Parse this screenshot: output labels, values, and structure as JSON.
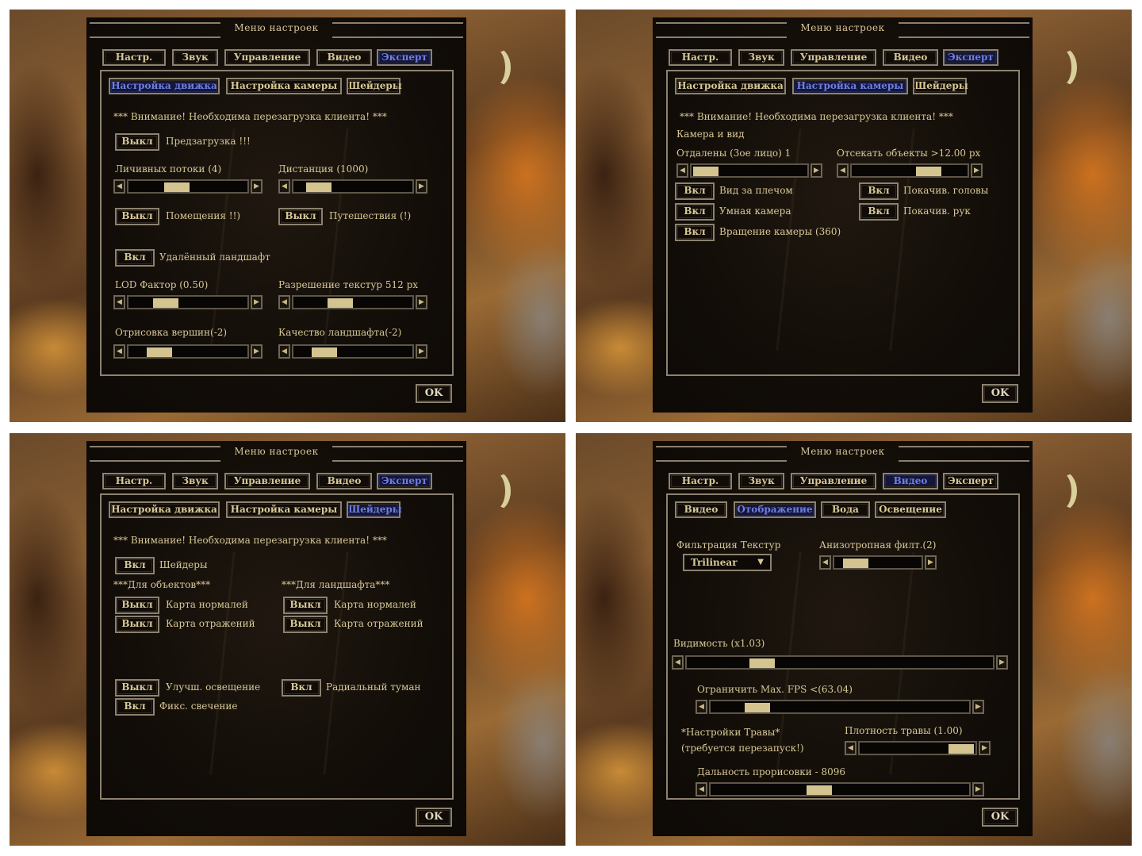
{
  "menu_title": "Меню настроек",
  "main_tabs": [
    "Настр.",
    "Звук",
    "Управление",
    "Видео",
    "Эксперт"
  ],
  "ok_label": "OK",
  "expert_subtabs": [
    "Настройка движка",
    "Настройка камеры",
    "Шейдеры"
  ],
  "restart_warning": "*** Внимание! Необходима перезагрузка клиента! ***",
  "colors": {
    "text_gold": "#d8c896",
    "active_blue": "#6f7fe0",
    "panel_bg": "#120d08",
    "thumb": "#d4c48f",
    "frame": "#8c826f"
  },
  "screens": [
    {
      "active_main_tab": "Эксперт",
      "active_subtab": "Настройка движка",
      "toggles": [
        {
          "state": "Выкл",
          "label": "Предзагрузка !!!"
        },
        {
          "state": "Выкл",
          "label": "Помещения !!)"
        },
        {
          "state": "Выкл",
          "label": "Путешествия (!)"
        },
        {
          "state": "Вкл",
          "label": "Удалённый ландшафт"
        }
      ],
      "sliders": [
        {
          "label": "Личивных потоки (4)",
          "position": 0.38
        },
        {
          "label": "Дистанция (1000)",
          "position": 0.12
        },
        {
          "label": "LOD Фактор (0.50)",
          "position": 0.25
        },
        {
          "label": "Разрешение текстур 512 px",
          "position": 0.36
        },
        {
          "label": "Отрисовка вершин(-2)",
          "position": 0.18
        },
        {
          "label": "Качество ландшафта(-2)",
          "position": 0.18
        }
      ]
    },
    {
      "active_main_tab": "Эксперт",
      "active_subtab": "Настройка камеры",
      "section_label": "Камера и вид",
      "sliders": [
        {
          "label": "Отдалены (3ое лицо) 1",
          "position": 0.0
        },
        {
          "label": "Отсекать объекты >12.00 px",
          "position": 0.72
        }
      ],
      "toggles": [
        {
          "state": "Вкл",
          "label": "Вид за плечом"
        },
        {
          "state": "Вкл",
          "label": "Умная камера"
        },
        {
          "state": "Вкл",
          "label": "Вращение камеры (360)"
        },
        {
          "state": "Вкл",
          "label": "Покачив. головы"
        },
        {
          "state": "Вкл",
          "label": "Покачив. рук"
        }
      ]
    },
    {
      "active_main_tab": "Эксперт",
      "active_subtab": "Шейдеры",
      "toggles": [
        {
          "state": "Вкл",
          "label": "Шейдеры"
        },
        {
          "state": "Выкл",
          "label": "Карта нормалей"
        },
        {
          "state": "Выкл",
          "label": "Карта отражений"
        },
        {
          "state": "Выкл",
          "label": "Карта нормалей"
        },
        {
          "state": "Выкл",
          "label": "Карта отражений"
        },
        {
          "state": "Выкл",
          "label": "Улучш. освещение"
        },
        {
          "state": "Вкл",
          "label": "Фикс. свечение"
        },
        {
          "state": "Вкл",
          "label": "Радиальный туман"
        }
      ],
      "group_objects": "***Для объектов***",
      "group_landscape": "***Для ландшафта***"
    },
    {
      "active_main_tab": "Видео",
      "video_subtabs": [
        "Видео",
        "Отображение",
        "Вода",
        "Освещение"
      ],
      "active_subtab": "Отображение",
      "texture_filter_label": "Фильтрация Текстур",
      "texture_filter_value": "Trilinear",
      "sliders": [
        {
          "label": "Анизотропная филт.(2)",
          "position": 0.12
        },
        {
          "label": "Видимость (x1.03)",
          "position": 0.22
        },
        {
          "label": "Ограничить Мах. FPS <(63.04)",
          "position": 0.14
        },
        {
          "label": "Плотность травы (1.00)",
          "position": 1.0
        },
        {
          "label": "Дальность прорисовки - 8096",
          "position": 0.41
        }
      ],
      "grass_label": "*Настройки Травы*",
      "grass_note": "(требуется перезапуск!)"
    }
  ]
}
